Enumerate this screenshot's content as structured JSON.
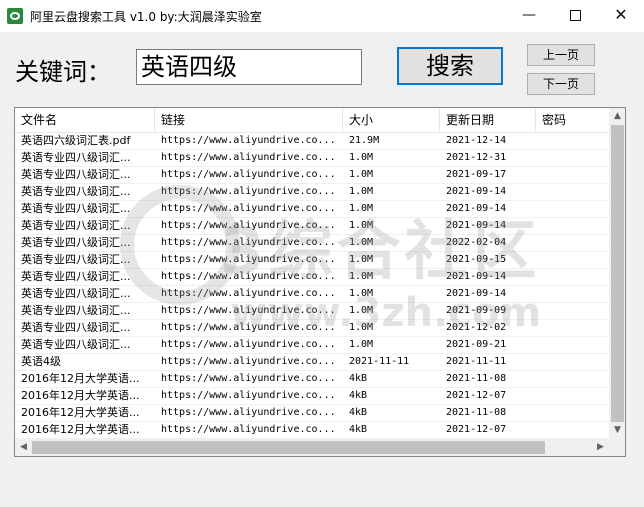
{
  "window": {
    "title": "阿里云盘搜索工具 v1.0  by:大润晨泽实验室",
    "icon": "aliyun-drive-icon",
    "controls": {
      "minimize": "—",
      "close": "✕"
    }
  },
  "search": {
    "label": "关键词：",
    "value": "英语四级",
    "button": "搜索"
  },
  "paging": {
    "prev": "上一页",
    "next": "下一页"
  },
  "table": {
    "columns": [
      "文件名",
      "链接",
      "大小",
      "更新日期",
      "密码"
    ],
    "rows": [
      [
        "英语四六级词汇表.pdf",
        "https://www.aliyundrive.co...",
        "21.9M",
        "2021-12-14",
        ""
      ],
      [
        "英语专业四八级词汇...",
        "https://www.aliyundrive.co...",
        "1.0M",
        "2021-12-31",
        ""
      ],
      [
        "英语专业四八级词汇...",
        "https://www.aliyundrive.co...",
        "1.0M",
        "2021-09-17",
        ""
      ],
      [
        "英语专业四八级词汇...",
        "https://www.aliyundrive.co...",
        "1.0M",
        "2021-09-14",
        ""
      ],
      [
        "英语专业四八级词汇...",
        "https://www.aliyundrive.co...",
        "1.0M",
        "2021-09-14",
        ""
      ],
      [
        "英语专业四八级词汇...",
        "https://www.aliyundrive.co...",
        "1.0M",
        "2021-09-14",
        ""
      ],
      [
        "英语专业四八级词汇...",
        "https://www.aliyundrive.co...",
        "1.0M",
        "2022-02-04",
        ""
      ],
      [
        "英语专业四八级词汇...",
        "https://www.aliyundrive.co...",
        "1.0M",
        "2021-09-15",
        ""
      ],
      [
        "英语专业四八级词汇...",
        "https://www.aliyundrive.co...",
        "1.0M",
        "2021-09-14",
        ""
      ],
      [
        "英语专业四八级词汇...",
        "https://www.aliyundrive.co...",
        "1.0M",
        "2021-09-14",
        ""
      ],
      [
        "英语专业四八级词汇...",
        "https://www.aliyundrive.co...",
        "1.0M",
        "2021-09-09",
        ""
      ],
      [
        "英语专业四八级词汇...",
        "https://www.aliyundrive.co...",
        "1.0M",
        "2021-12-02",
        ""
      ],
      [
        "英语专业四八级词汇...",
        "https://www.aliyundrive.co...",
        "1.0M",
        "2021-09-21",
        ""
      ],
      [
        "英语4级",
        "https://www.aliyundrive.co...",
        "2021-11-11",
        "2021-11-11",
        ""
      ],
      [
        "2016年12月大学英语...",
        "https://www.aliyundrive.co...",
        "4kB",
        "2021-11-08",
        ""
      ],
      [
        "2016年12月大学英语...",
        "https://www.aliyundrive.co...",
        "4kB",
        "2021-12-07",
        ""
      ],
      [
        "2016年12月大学英语...",
        "https://www.aliyundrive.co...",
        "4kB",
        "2021-11-08",
        ""
      ],
      [
        "2016年12月大学英语...",
        "https://www.aliyundrive.co...",
        "4kB",
        "2021-12-07",
        ""
      ],
      [
        "2016年12月大学英语...",
        "https://www.aliyundrive.co...",
        "4kB",
        "2021-11-08",
        ""
      ]
    ]
  },
  "watermark": {
    "text": "3综合社区",
    "url": "www.3zh.com"
  }
}
